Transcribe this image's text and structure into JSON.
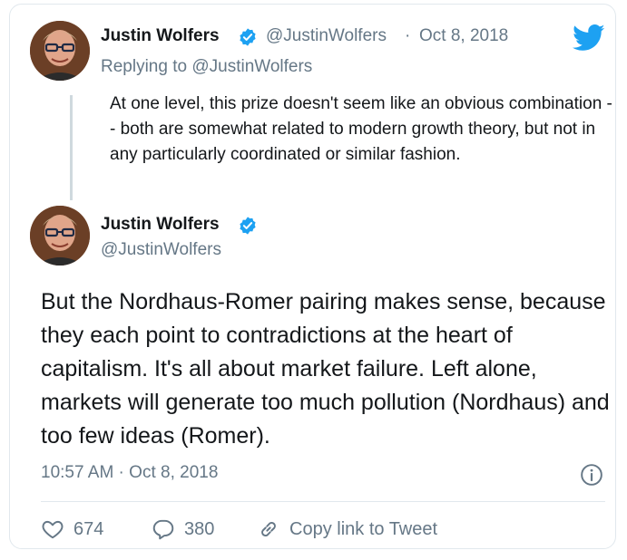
{
  "reply_tweet": {
    "author_name": "Justin Wolfers",
    "handle": "@JustinWolfers",
    "separator": "·",
    "date": "Oct 8, 2018",
    "replying_to": "Replying to @JustinWolfers",
    "text": "At one level, this prize doesn't seem like an obvious combination -- both are somewhat related to modern growth theory, but not in any particularly coordinated or similar fashion."
  },
  "main_tweet": {
    "author_name": "Justin Wolfers",
    "handle": "@JustinWolfers",
    "text": "But the Nordhaus-Romer pairing makes sense, because they each point to contradictions at the heart of capitalism. It's all about market failure. Left alone, markets will generate too much pollution (Nordhaus) and too few ideas (Romer).",
    "timestamp": "10:57 AM · Oct 8, 2018"
  },
  "actions": {
    "likes": "674",
    "replies": "380",
    "copy_link_label": "Copy link to Tweet"
  },
  "icons": {
    "verified": "verified-badge-icon",
    "brand": "twitter-bird-icon",
    "info": "info-icon",
    "like": "heart-icon",
    "reply": "reply-bubble-icon",
    "link": "link-icon"
  },
  "colors": {
    "brand_blue": "#1da1f2",
    "text_primary": "#14171a",
    "text_secondary": "#657786",
    "border": "#e1e8ed"
  }
}
